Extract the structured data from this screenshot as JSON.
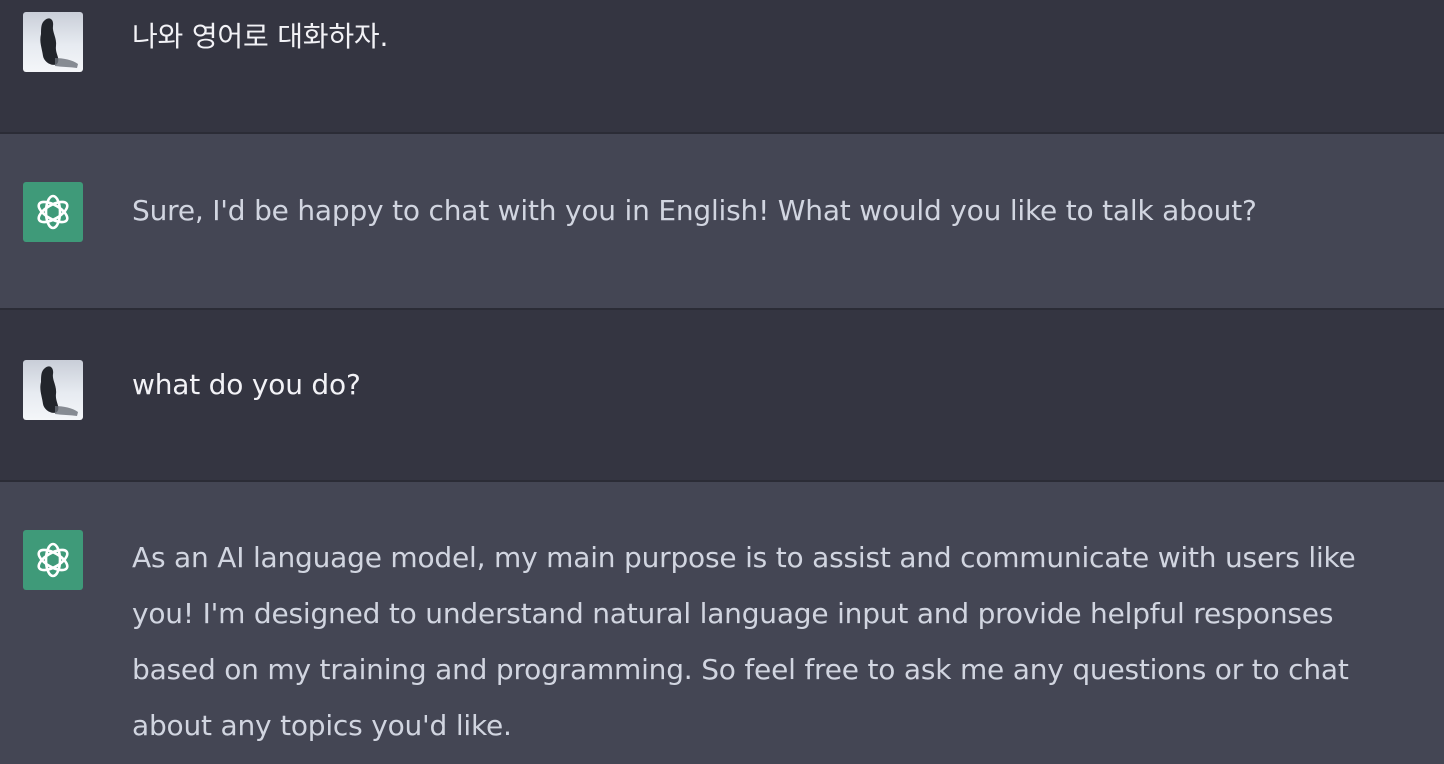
{
  "conversation": {
    "messages": [
      {
        "role": "user",
        "text": "나와 영어로 대화하자."
      },
      {
        "role": "assistant",
        "text": "Sure, I'd be happy to chat with you in English! What would you like to talk about?"
      },
      {
        "role": "user",
        "text": "what do you do?"
      },
      {
        "role": "assistant",
        "text": "As an AI language model, my main purpose is to assist and communicate with users like you! I'm designed to understand natural language input and provide helpful responses based on my training and programming. So feel free to ask me any questions or to chat about any topics you'd like."
      }
    ]
  },
  "icons": {
    "user_avatar": "user-photo-avatar",
    "assistant_avatar": "openai-logo-icon"
  },
  "colors": {
    "user_bg": "#343541",
    "assistant_bg": "#444654",
    "assistant_avatar_bg": "#3f9a79"
  }
}
